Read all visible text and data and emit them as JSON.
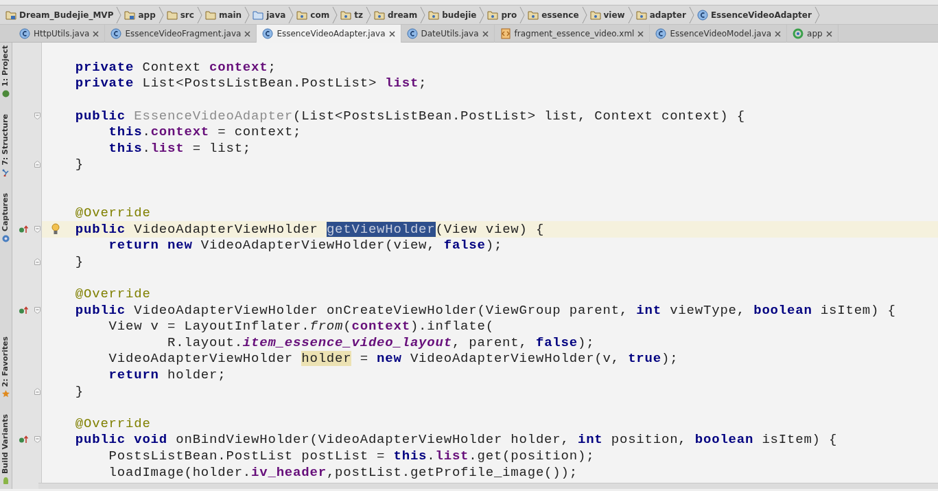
{
  "breadcrumbs": [
    {
      "label": "Dream_Budejie_MVP",
      "kind": "project"
    },
    {
      "label": "app",
      "kind": "module"
    },
    {
      "label": "src",
      "kind": "folder"
    },
    {
      "label": "main",
      "kind": "folder"
    },
    {
      "label": "java",
      "kind": "source"
    },
    {
      "label": "com",
      "kind": "package"
    },
    {
      "label": "tz",
      "kind": "package"
    },
    {
      "label": "dream",
      "kind": "package"
    },
    {
      "label": "budejie",
      "kind": "package"
    },
    {
      "label": "pro",
      "kind": "package"
    },
    {
      "label": "essence",
      "kind": "package"
    },
    {
      "label": "view",
      "kind": "package"
    },
    {
      "label": "adapter",
      "kind": "package"
    },
    {
      "label": "EssenceVideoAdapter",
      "kind": "class"
    }
  ],
  "tabs": [
    {
      "label": "HttpUtils.java",
      "kind": "class",
      "selected": false
    },
    {
      "label": "EssenceVideoFragment.java",
      "kind": "class",
      "selected": false
    },
    {
      "label": "EssenceVideoAdapter.java",
      "kind": "class",
      "selected": true
    },
    {
      "label": "DateUtils.java",
      "kind": "class",
      "selected": false
    },
    {
      "label": "fragment_essence_video.xml",
      "kind": "xml",
      "selected": false
    },
    {
      "label": "EssenceVideoModel.java",
      "kind": "class",
      "selected": false
    },
    {
      "label": "app",
      "kind": "module",
      "selected": false
    }
  ],
  "tool_strip": {
    "top": [
      {
        "label": "1: Project",
        "kind": "project"
      },
      {
        "label": "7: Structure",
        "kind": "structure"
      },
      {
        "label": "Captures",
        "kind": "captures"
      }
    ],
    "bottom": [
      {
        "label": "2: Favorites",
        "kind": "favorites"
      },
      {
        "label": "Build Variants",
        "kind": "variants"
      }
    ]
  },
  "lines": [
    {
      "current": false,
      "override_marker": false,
      "bulb": false,
      "fold_start": false,
      "fold_end": false,
      "tokens": [
        {
          "kind": "keyword",
          "text": "    private "
        },
        {
          "kind": "plain",
          "text": "Context "
        },
        {
          "kind": "field",
          "text": "context"
        },
        {
          "kind": "plain",
          "text": ";"
        }
      ]
    },
    {
      "current": false,
      "override_marker": false,
      "bulb": false,
      "fold_start": false,
      "fold_end": false,
      "tokens": [
        {
          "kind": "keyword",
          "text": "    private "
        },
        {
          "kind": "plain",
          "text": "List<PostsListBean.PostList> "
        },
        {
          "kind": "field",
          "text": "list"
        },
        {
          "kind": "plain",
          "text": ";"
        }
      ]
    },
    {
      "current": false,
      "override_marker": false,
      "bulb": false,
      "fold_start": false,
      "fold_end": false
    },
    {
      "current": false,
      "override_marker": false,
      "bulb": false,
      "fold_start": true,
      "fold_end": false,
      "tokens": [
        {
          "kind": "keyword",
          "text": "    public "
        },
        {
          "kind": "unused",
          "text": "EssenceVideoAdapter"
        },
        {
          "kind": "plain",
          "text": "(List<PostsListBean.PostList> list, Context context) {"
        }
      ]
    },
    {
      "current": false,
      "override_marker": false,
      "bulb": false,
      "fold_start": false,
      "fold_end": false,
      "tokens": [
        {
          "kind": "keyword",
          "text": "        this"
        },
        {
          "kind": "plain",
          "text": "."
        },
        {
          "kind": "field",
          "text": "context"
        },
        {
          "kind": "plain",
          "text": " = context;"
        }
      ]
    },
    {
      "current": false,
      "override_marker": false,
      "bulb": false,
      "fold_start": false,
      "fold_end": false,
      "tokens": [
        {
          "kind": "keyword",
          "text": "        this"
        },
        {
          "kind": "plain",
          "text": "."
        },
        {
          "kind": "field",
          "text": "list"
        },
        {
          "kind": "plain",
          "text": " = list;"
        }
      ]
    },
    {
      "current": false,
      "override_marker": false,
      "bulb": false,
      "fold_start": false,
      "fold_end": true,
      "tokens": [
        {
          "kind": "plain",
          "text": "    }"
        }
      ]
    },
    {
      "current": false,
      "override_marker": false,
      "bulb": false,
      "fold_start": false,
      "fold_end": false
    },
    {
      "current": false,
      "override_marker": false,
      "bulb": false,
      "fold_start": false,
      "fold_end": false
    },
    {
      "current": false,
      "override_marker": false,
      "bulb": false,
      "fold_start": false,
      "fold_end": false,
      "tokens": [
        {
          "kind": "annotation",
          "text": "    @Override"
        }
      ]
    },
    {
      "current": true,
      "override_marker": true,
      "bulb": true,
      "fold_start": true,
      "fold_end": false,
      "tokens": [
        {
          "kind": "keyword",
          "text": "    public "
        },
        {
          "kind": "plain",
          "text": "VideoAdapterViewHolder "
        },
        {
          "kind": "selection",
          "text": "getViewHolder"
        },
        {
          "kind": "plain",
          "text": "(View view) {"
        }
      ]
    },
    {
      "current": false,
      "override_marker": false,
      "bulb": false,
      "fold_start": false,
      "fold_end": false,
      "tokens": [
        {
          "kind": "keyword",
          "text": "        return new "
        },
        {
          "kind": "plain",
          "text": "VideoAdapterViewHolder(view, "
        },
        {
          "kind": "keyword",
          "text": "false"
        },
        {
          "kind": "plain",
          "text": ");"
        }
      ]
    },
    {
      "current": false,
      "override_marker": false,
      "bulb": false,
      "fold_start": false,
      "fold_end": true,
      "tokens": [
        {
          "kind": "plain",
          "text": "    }"
        }
      ]
    },
    {
      "current": false,
      "override_marker": false,
      "bulb": false,
      "fold_start": false,
      "fold_end": false
    },
    {
      "current": false,
      "override_marker": false,
      "bulb": false,
      "fold_start": false,
      "fold_end": false,
      "tokens": [
        {
          "kind": "annotation",
          "text": "    @Override"
        }
      ]
    },
    {
      "current": false,
      "override_marker": true,
      "bulb": false,
      "fold_start": true,
      "fold_end": false,
      "tokens": [
        {
          "kind": "keyword",
          "text": "    public "
        },
        {
          "kind": "plain",
          "text": "VideoAdapterViewHolder onCreateViewHolder(ViewGroup parent, "
        },
        {
          "kind": "keyword",
          "text": "int "
        },
        {
          "kind": "plain",
          "text": "viewType, "
        },
        {
          "kind": "keyword",
          "text": "boolean "
        },
        {
          "kind": "plain",
          "text": "isItem) {"
        }
      ]
    },
    {
      "current": false,
      "override_marker": false,
      "bulb": false,
      "fold_start": false,
      "fold_end": false,
      "tokens": [
        {
          "kind": "plain",
          "text": "        View v = LayoutInflater."
        },
        {
          "kind": "static_method",
          "text": "from"
        },
        {
          "kind": "plain",
          "text": "("
        },
        {
          "kind": "field",
          "text": "context"
        },
        {
          "kind": "plain",
          "text": ").inflate("
        }
      ]
    },
    {
      "current": false,
      "override_marker": false,
      "bulb": false,
      "fold_start": false,
      "fold_end": false,
      "tokens": [
        {
          "kind": "plain",
          "text": "               R.layout."
        },
        {
          "kind": "static_field",
          "text": "item_essence_video_layout"
        },
        {
          "kind": "plain",
          "text": ", parent, "
        },
        {
          "kind": "keyword",
          "text": "false"
        },
        {
          "kind": "plain",
          "text": ");"
        }
      ]
    },
    {
      "current": false,
      "override_marker": false,
      "bulb": false,
      "fold_start": false,
      "fold_end": false,
      "tokens": [
        {
          "kind": "plain",
          "text": "        VideoAdapterViewHolder "
        },
        {
          "kind": "usage",
          "text": "holder"
        },
        {
          "kind": "plain",
          "text": " = "
        },
        {
          "kind": "keyword",
          "text": "new "
        },
        {
          "kind": "plain",
          "text": "VideoAdapterViewHolder(v, "
        },
        {
          "kind": "keyword",
          "text": "true"
        },
        {
          "kind": "plain",
          "text": ");"
        }
      ]
    },
    {
      "current": false,
      "override_marker": false,
      "bulb": false,
      "fold_start": false,
      "fold_end": false,
      "tokens": [
        {
          "kind": "keyword",
          "text": "        return "
        },
        {
          "kind": "plain",
          "text": "holder;"
        }
      ]
    },
    {
      "current": false,
      "override_marker": false,
      "bulb": false,
      "fold_start": false,
      "fold_end": true,
      "tokens": [
        {
          "kind": "plain",
          "text": "    }"
        }
      ]
    },
    {
      "current": false,
      "override_marker": false,
      "bulb": false,
      "fold_start": false,
      "fold_end": false
    },
    {
      "current": false,
      "override_marker": false,
      "bulb": false,
      "fold_start": false,
      "fold_end": false,
      "tokens": [
        {
          "kind": "annotation",
          "text": "    @Override"
        }
      ]
    },
    {
      "current": false,
      "override_marker": true,
      "bulb": false,
      "fold_start": true,
      "fold_end": false,
      "tokens": [
        {
          "kind": "keyword",
          "text": "    public void "
        },
        {
          "kind": "plain",
          "text": "onBindViewHolder(VideoAdapterViewHolder holder, "
        },
        {
          "kind": "keyword",
          "text": "int "
        },
        {
          "kind": "plain",
          "text": "position, "
        },
        {
          "kind": "keyword",
          "text": "boolean "
        },
        {
          "kind": "plain",
          "text": "isItem) {"
        }
      ]
    },
    {
      "current": false,
      "override_marker": false,
      "bulb": false,
      "fold_start": false,
      "fold_end": false,
      "tokens": [
        {
          "kind": "plain",
          "text": "        PostsListBean.PostList postList = "
        },
        {
          "kind": "keyword",
          "text": "this"
        },
        {
          "kind": "plain",
          "text": "."
        },
        {
          "kind": "field",
          "text": "list"
        },
        {
          "kind": "plain",
          "text": ".get(position);"
        }
      ]
    },
    {
      "current": false,
      "override_marker": false,
      "bulb": false,
      "fold_start": false,
      "fold_end": false,
      "tokens": [
        {
          "kind": "plain",
          "text": "        loadImage(holder."
        },
        {
          "kind": "field",
          "text": "iv_header"
        },
        {
          "kind": "plain",
          "text": ",postList.getProfile_image());"
        }
      ]
    }
  ]
}
